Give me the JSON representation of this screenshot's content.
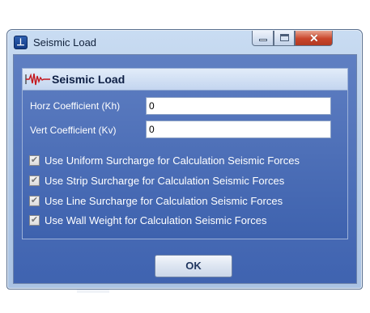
{
  "window": {
    "title": "Seismic Load",
    "icon": "app-icon",
    "controls": {
      "minimize": "minimize-icon",
      "maximize": "maximize-icon",
      "close": "close-icon"
    }
  },
  "panel": {
    "title": "Seismic Load",
    "icon": "seismograph-icon"
  },
  "fields": {
    "horz_label": "Horz Coefficient (Kh)",
    "horz_value": "0",
    "vert_label": "Vert Coefficient (Kv)",
    "vert_value": "0"
  },
  "options": [
    {
      "label": "Use Uniform Surcharge for Calculation Seismic Forces",
      "checked": true
    },
    {
      "label": "Use Strip Surcharge for Calculation Seismic Forces",
      "checked": true
    },
    {
      "label": "Use Line Surcharge for Calculation Seismic Forces",
      "checked": true
    },
    {
      "label": "Use Wall Weight  for Calculation Seismic Forces",
      "checked": true
    }
  ],
  "buttons": {
    "ok_label": "OK"
  },
  "colors": {
    "client_bg": "#3f63b0",
    "header_bg": "#c3d5ef",
    "close_red": "#c9452b"
  }
}
